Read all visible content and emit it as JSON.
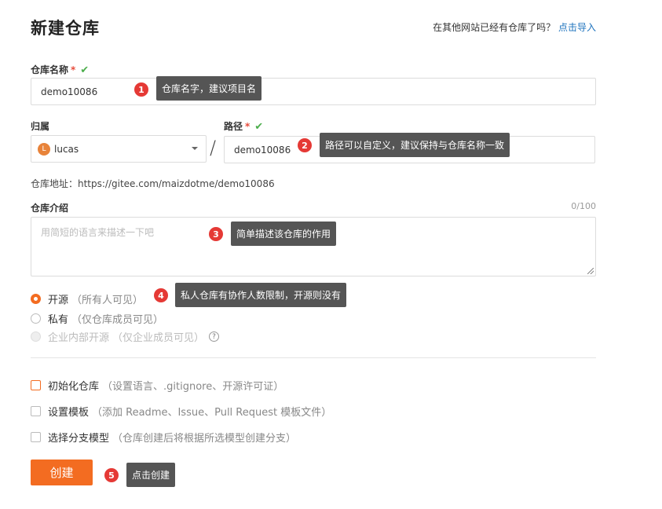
{
  "header": {
    "title": "新建仓库",
    "import_prompt": "在其他网站已经有仓库了吗？",
    "import_link": "点击导入"
  },
  "repo_name": {
    "label": "仓库名称",
    "required_mark": "*",
    "value": "demo10086"
  },
  "owner": {
    "label": "归属",
    "avatar_letter": "L",
    "value": "lucas"
  },
  "path": {
    "label": "路径",
    "required_mark": "*",
    "value": "demo10086"
  },
  "separator": "/",
  "repo_address": "仓库地址：https://gitee.com/maizdotme/demo10086",
  "description": {
    "label": "仓库介绍",
    "counter": "0/100",
    "placeholder": "用简短的语言来描述一下吧"
  },
  "visibility": [
    {
      "label": "开源",
      "note": "（所有人可见）",
      "selected": true,
      "disabled": false
    },
    {
      "label": "私有",
      "note": "（仅仓库成员可见）",
      "selected": false,
      "disabled": false
    },
    {
      "label": "企业内部开源",
      "note": "（仅企业成员可见）",
      "selected": false,
      "disabled": true
    }
  ],
  "options": [
    {
      "label": "初始化仓库",
      "note": "（设置语言、.gitignore、开源许可证）",
      "checked": false
    },
    {
      "label": "设置模板",
      "note": "（添加 Readme、Issue、Pull Request 模板文件）",
      "checked": false
    },
    {
      "label": "选择分支模型",
      "note": "（仓库创建后将根据所选模型创建分支）",
      "checked": false
    }
  ],
  "submit": {
    "label": "创建"
  },
  "annotations": [
    {
      "num": "1",
      "text": "仓库名字，建议项目名"
    },
    {
      "num": "2",
      "text": "路径可以自定义，建议保持与仓库名称一致"
    },
    {
      "num": "3",
      "text": "简单描述该仓库的作用"
    },
    {
      "num": "4",
      "text": "私人仓库有协作人数限制，开源则没有"
    },
    {
      "num": "5",
      "text": "点击创建"
    }
  ],
  "colors": {
    "accent": "#f36c21",
    "link": "#1e73be",
    "required": "#e74c3c",
    "valid_check": "#4cae4c",
    "badge": "#e53935",
    "tooltip": "#555555"
  },
  "icons": {
    "valid": "check-icon",
    "dropdown": "chevron-down-icon",
    "help": "question-circle-icon"
  }
}
